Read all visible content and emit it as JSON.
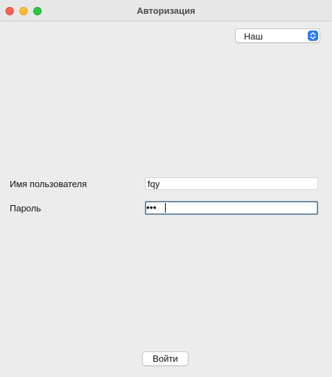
{
  "window": {
    "title": "Авторизация"
  },
  "source_dropdown": {
    "selected": "Наш"
  },
  "form": {
    "username_label": "Имя пользователя",
    "username_value": "fqy",
    "password_label": "Пароль",
    "password_value": "•••"
  },
  "actions": {
    "login_label": "Войти"
  },
  "colors": {
    "accent": "#2f7cf6",
    "close": "#fe5f57",
    "minimize": "#febc2e",
    "maximize": "#28c840"
  }
}
